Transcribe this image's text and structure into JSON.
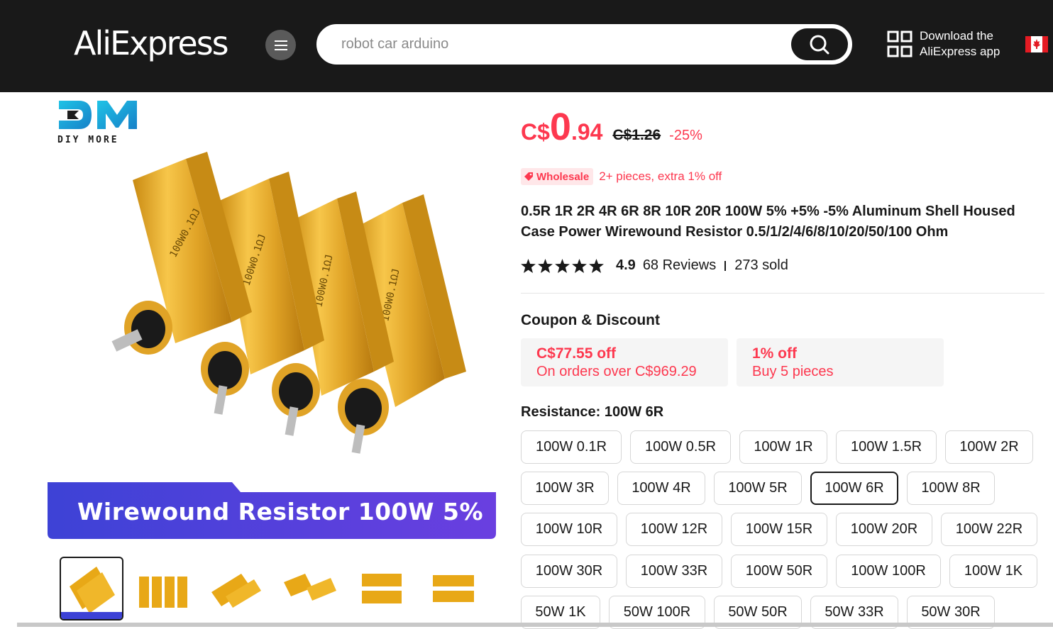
{
  "header": {
    "logo": "AliExpress",
    "search_placeholder": "robot car arduino",
    "app_line1": "Download the",
    "app_line2": "AliExpress app"
  },
  "gallery": {
    "brand_text": "DIY MORE",
    "banner": "Wirewound Resistor 100W 5%",
    "thumbnail_count": 6
  },
  "price": {
    "currency": "C$",
    "integer": "0",
    "decimal": ".94",
    "original": "C$1.26",
    "discount": "-25%"
  },
  "wholesale": {
    "badge": "Wholesale",
    "text": "2+ pieces, extra 1% off"
  },
  "product": {
    "title": "0.5R 1R 2R 4R 6R 8R 10R 20R 100W 5% +5% -5% Aluminum Shell Housed Case Power Wirewound Resistor 0.5/1/2/4/6/8/10/20/50/100 Ohm"
  },
  "rating": {
    "score": "4.9",
    "reviews": "68 Reviews",
    "sold": "273 sold"
  },
  "coupons": {
    "title": "Coupon & Discount",
    "items": [
      {
        "main": "C$77.55 off",
        "sub": "On orders over C$969.29"
      },
      {
        "main": "1% off",
        "sub": "Buy 5 pieces"
      }
    ]
  },
  "resistance": {
    "label": "Resistance: 100W 6R",
    "options": [
      "100W 0.1R",
      "100W 0.5R",
      "100W 1R",
      "100W 1.5R",
      "100W 2R",
      "100W 3R",
      "100W 4R",
      "100W 5R",
      "100W 6R",
      "100W 8R",
      "100W 10R",
      "100W 12R",
      "100W 15R",
      "100W 20R",
      "100W 22R",
      "100W 30R",
      "100W 33R",
      "100W 50R",
      "100W 100R",
      "100W 1K",
      "50W 1K",
      "50W 100R",
      "50W 50R",
      "50W 33R",
      "50W 30R"
    ],
    "selected": "100W 6R"
  },
  "colors": {
    "accent": "#fd384f",
    "header_bg": "#191919",
    "gold": "#e8a817",
    "banner": "#3d42d6"
  }
}
